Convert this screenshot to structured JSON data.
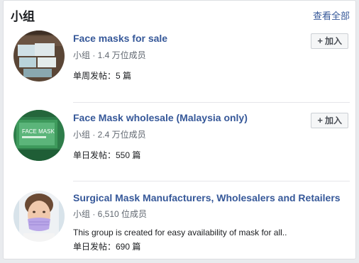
{
  "header": {
    "title": "小组",
    "see_all": "查看全部"
  },
  "groups": [
    {
      "name": "Face masks for sale",
      "meta": "小组 · 1.4 万位成员",
      "posts": "单周发帖：5 篇",
      "join_label": "加入"
    },
    {
      "name": "Face Mask wholesale (Malaysia only)",
      "meta": "小组 · 2.4 万位成员",
      "posts": "单日发帖：550 篇",
      "join_label": "加入",
      "avatar_text": "FACE MASK"
    },
    {
      "name": "Surgical Mask Manufacturers, Wholesalers and Retailers",
      "meta": "小组 · 6,510 位成员",
      "description": "This group is created for easy availability of mask for all..",
      "posts": "单日发帖：690 篇"
    }
  ],
  "colors": {
    "link": "#365899",
    "text": "#1c1e21",
    "secondary": "#606770"
  }
}
